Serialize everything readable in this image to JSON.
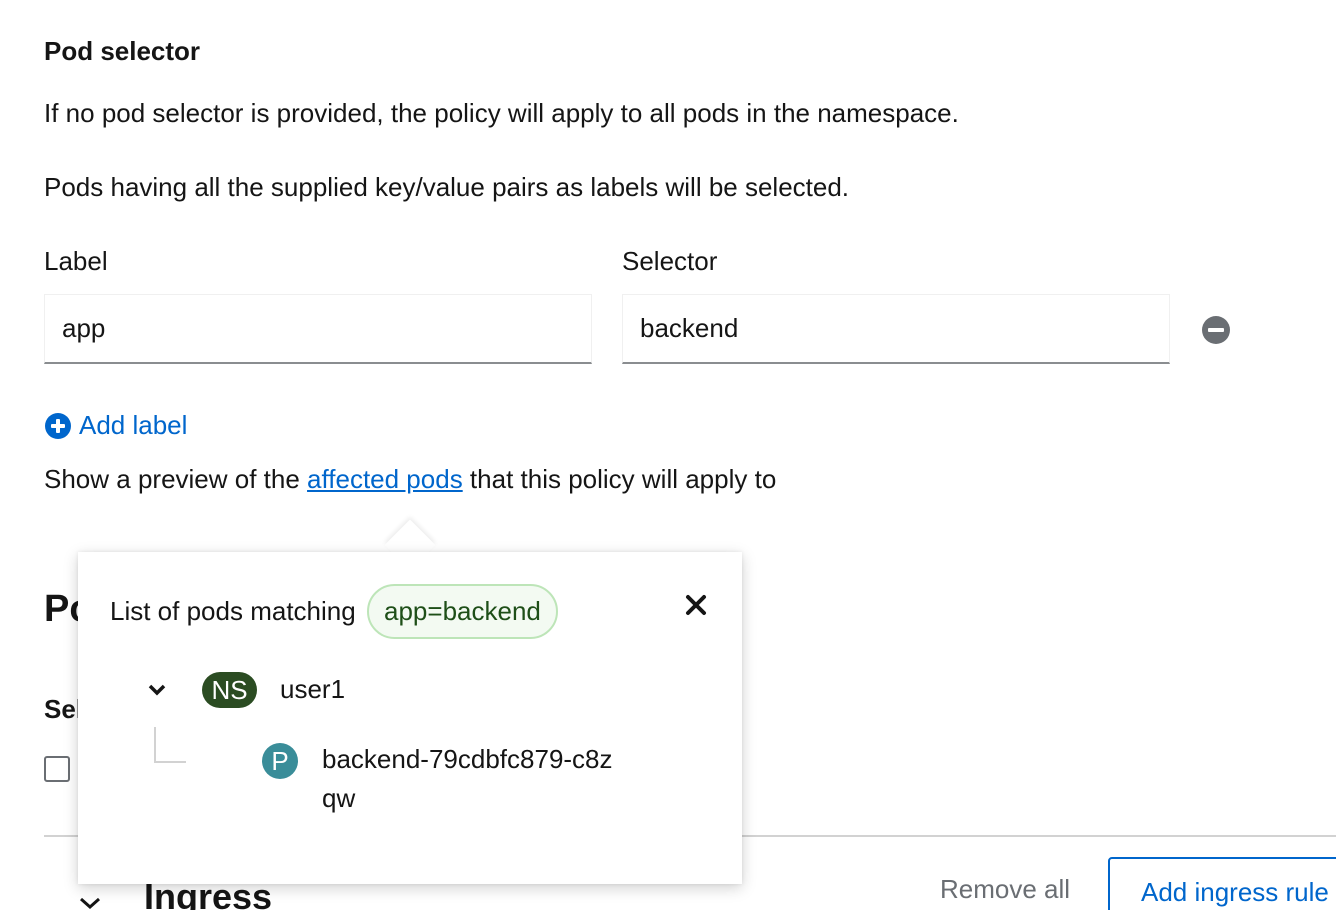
{
  "pod_selector": {
    "title": "Pod selector",
    "help_text_1": "If no pod selector is provided, the policy will apply to all pods in the namespace.",
    "help_text_2": "Pods having all the supplied key/value pairs as labels will be selected.",
    "label_header": "Label",
    "selector_header": "Selector",
    "label_value": "app",
    "selector_value": "backend",
    "add_label": "Add label",
    "preview_prefix": "Show a preview of the ",
    "preview_link": "affected pods",
    "preview_suffix": " that this policy will apply to"
  },
  "background": {
    "heading_fragment": "Po",
    "select_fragment": "Sel",
    "ingress_title": "Ingress",
    "remove_all": "Remove all",
    "add_ingress_rule": "Add ingress rule"
  },
  "popover": {
    "title": "List of pods matching",
    "selector_chip": "app=backend",
    "namespace_badge": "NS",
    "namespace_name": "user1",
    "pod_badge": "P",
    "pod_name": "backend-79cdbfc879-c8zqw"
  },
  "colors": {
    "link": "#0066cc",
    "ns_badge": "#2b4c22",
    "pod_badge": "#3a8d99",
    "chip_border": "#bde5b8"
  },
  "icons": {
    "remove": "minus-circle-icon",
    "add": "plus-circle-icon",
    "close": "times-icon",
    "toggle": "chevron-down-icon"
  }
}
